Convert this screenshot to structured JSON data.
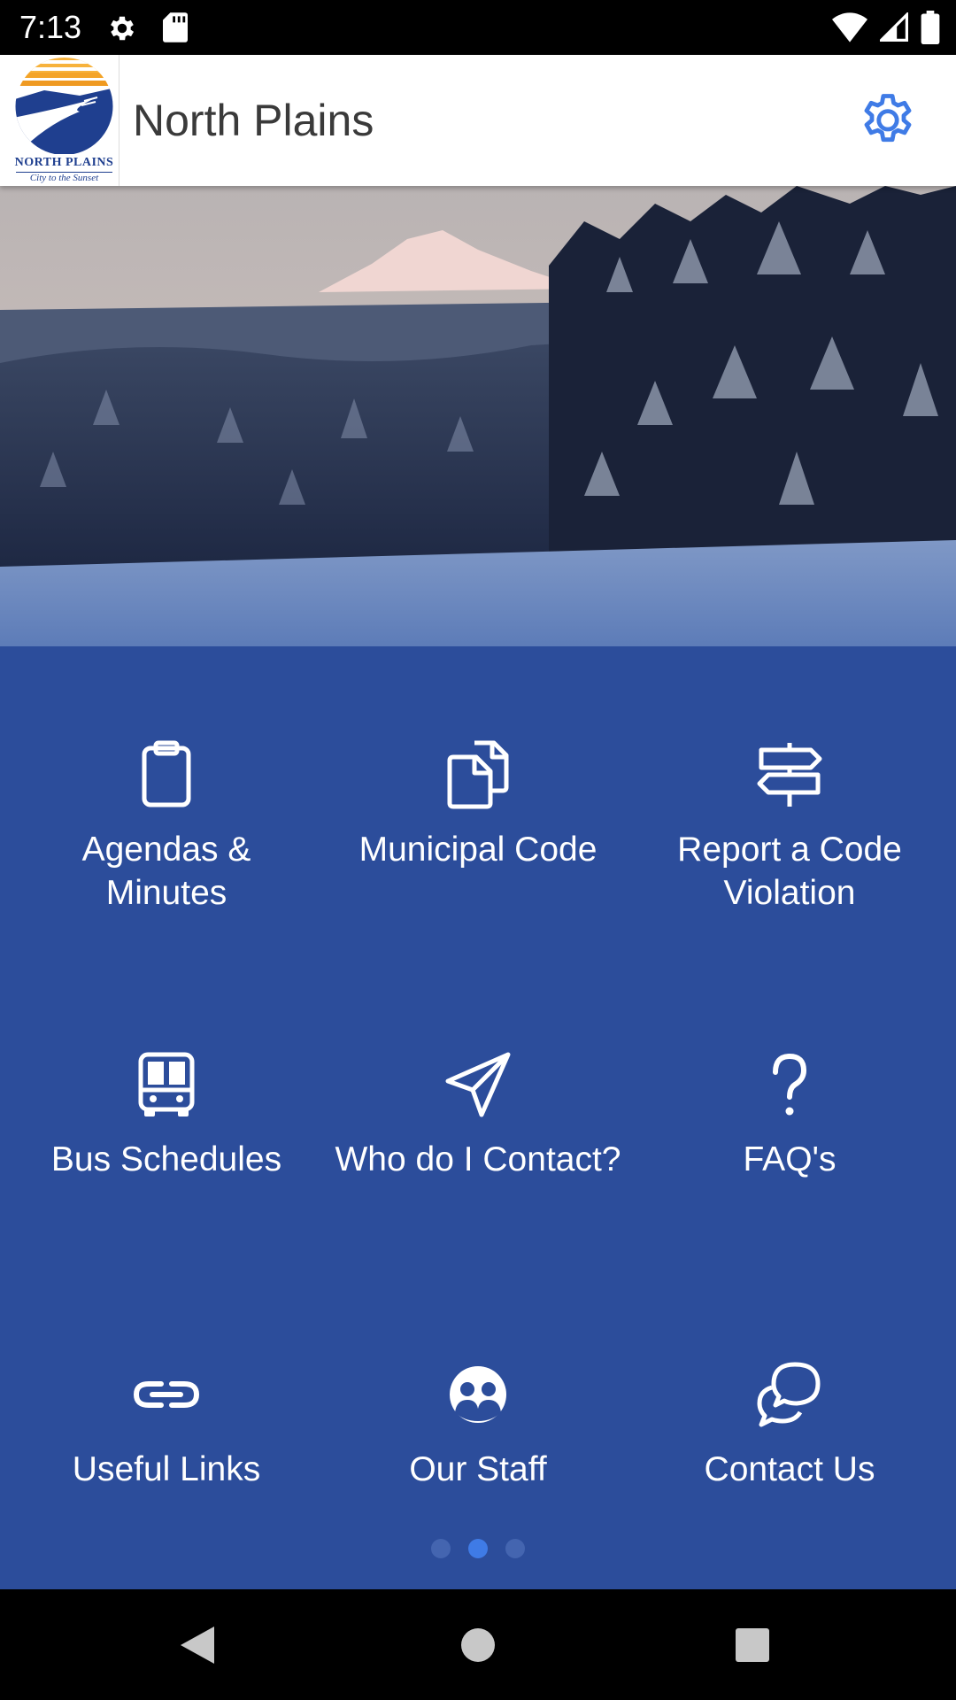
{
  "status": {
    "time": "7:13"
  },
  "app": {
    "title": "North Plains",
    "logo_name": "NORTH PLAINS",
    "logo_tagline": "City to the Sunset"
  },
  "tiles": [
    {
      "label": "Agendas & Minutes",
      "icon": "clipboard-icon"
    },
    {
      "label": "Municipal Code",
      "icon": "documents-icon"
    },
    {
      "label": "Report a Code Violation",
      "icon": "signpost-icon"
    },
    {
      "label": "Bus Schedules",
      "icon": "bus-icon"
    },
    {
      "label": "Who do I Contact?",
      "icon": "paper-plane-icon"
    },
    {
      "label": "FAQ's",
      "icon": "question-icon"
    },
    {
      "label": "Useful Links",
      "icon": "link-icon"
    },
    {
      "label": "Our Staff",
      "icon": "people-icon"
    },
    {
      "label": "Contact Us",
      "icon": "chat-bubbles-icon"
    }
  ],
  "pager": {
    "pages": 3,
    "active": 1
  },
  "colors": {
    "panel": "#2c4d9b",
    "accent": "#3f7be6",
    "title": "#3a3a3a"
  }
}
